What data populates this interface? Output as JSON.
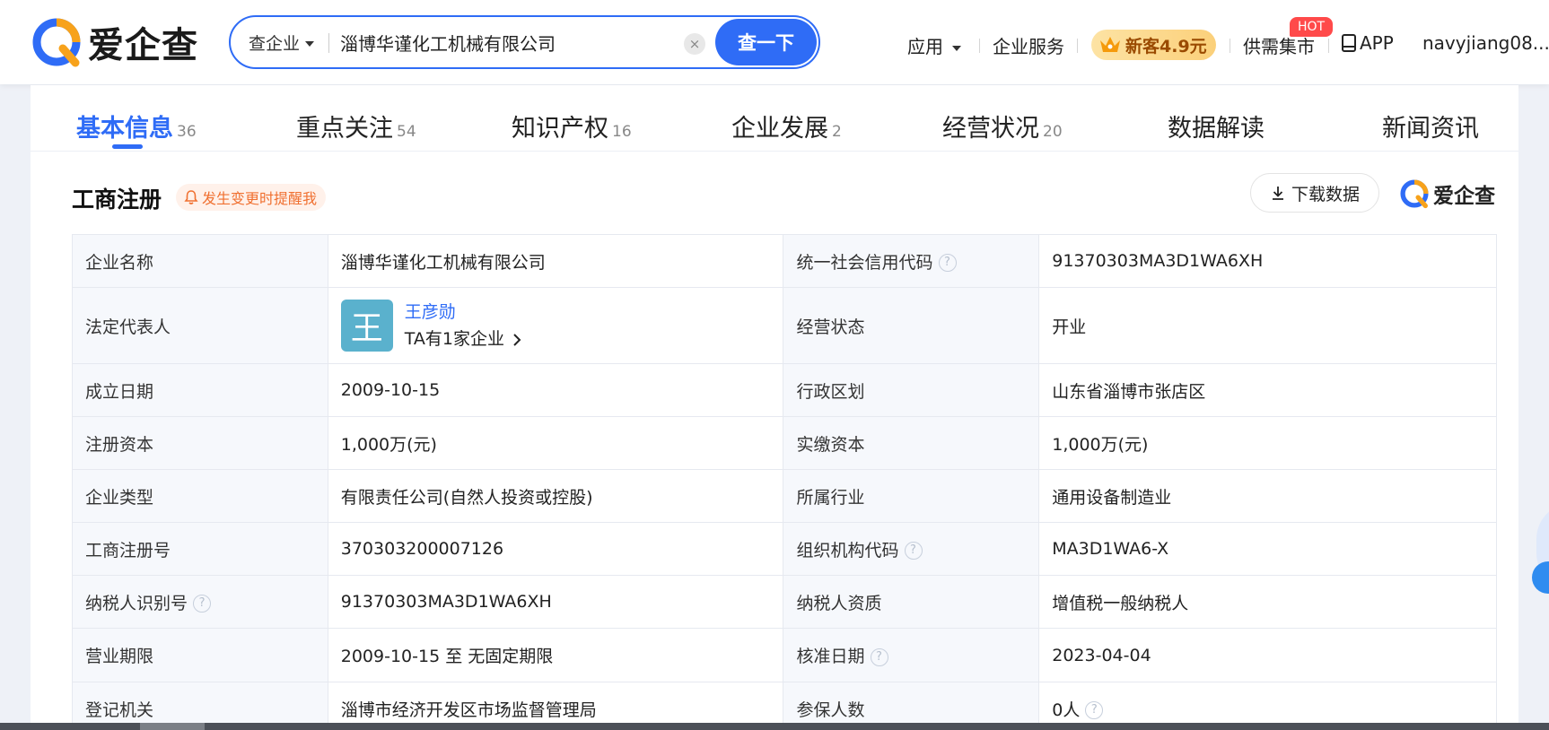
{
  "brand": {
    "name": "爱企查"
  },
  "search": {
    "type_label": "查企业",
    "value": "淄博华谨化工机械有限公司",
    "clear_label": "×",
    "button_label": "查一下"
  },
  "nav": {
    "app_label": "应用",
    "service_label": "企业服务",
    "promo_label": "新客4.9元",
    "market_label": "供需集市",
    "hot_badge": "HOT",
    "app_download_label": "APP",
    "username": "navyjiang08..."
  },
  "tabs": [
    {
      "label": "基本信息",
      "count": "36"
    },
    {
      "label": "重点关注",
      "count": "54"
    },
    {
      "label": "知识产权",
      "count": "16"
    },
    {
      "label": "企业发展",
      "count": "2"
    },
    {
      "label": "经营状况",
      "count": "20"
    },
    {
      "label": "数据解读",
      "count": ""
    },
    {
      "label": "新闻资讯",
      "count": ""
    }
  ],
  "section": {
    "title": "工商注册",
    "remind_label": "发生变更时提醒我",
    "download_label": "下载数据",
    "watermark": "爱企查"
  },
  "table": {
    "company_name": {
      "label": "企业名称",
      "value": "淄博华谨化工机械有限公司"
    },
    "credit_code": {
      "label": "统一社会信用代码",
      "value": "91370303MA3D1WA6XH"
    },
    "legal_rep": {
      "label": "法定代表人",
      "avatar_char": "王",
      "name": "王彦勋",
      "sub": "TA有1家企业"
    },
    "status": {
      "label": "经营状态",
      "value": "开业"
    },
    "founded": {
      "label": "成立日期",
      "value": "2009-10-15"
    },
    "region": {
      "label": "行政区划",
      "value": "山东省淄博市张店区"
    },
    "reg_capital": {
      "label": "注册资本",
      "value": "1,000万(元)"
    },
    "paid_capital": {
      "label": "实缴资本",
      "value": "1,000万(元)"
    },
    "company_type": {
      "label": "企业类型",
      "value": "有限责任公司(自然人投资或控股)"
    },
    "industry": {
      "label": "所属行业",
      "value": "通用设备制造业"
    },
    "reg_number": {
      "label": "工商注册号",
      "value": "370303200007126"
    },
    "org_code": {
      "label": "组织机构代码",
      "value": "MA3D1WA6-X"
    },
    "taxpayer_id": {
      "label": "纳税人识别号",
      "value": "91370303MA3D1WA6XH"
    },
    "taxpayer_qual": {
      "label": "纳税人资质",
      "value": "增值税一般纳税人"
    },
    "term": {
      "label": "营业期限",
      "value": "2009-10-15 至 无固定期限"
    },
    "approval_date": {
      "label": "核准日期",
      "value": "2023-04-04"
    },
    "authority": {
      "label": "登记机关",
      "value": "淄博市经济开发区市场监督管理局"
    },
    "insured": {
      "label": "参保人数",
      "value": "0人"
    }
  },
  "colors": {
    "accent": "#2f6cf6",
    "remind": "#f07030",
    "promo_bg": "#fbd07a",
    "hot": "#ff4a4a",
    "avatar": "#5ab1cd"
  },
  "icons": [
    "search-logo-icon",
    "crown-icon",
    "bell-icon",
    "download-icon",
    "help-icon",
    "chevron-right-icon",
    "phone-icon",
    "caret-down-icon"
  ]
}
